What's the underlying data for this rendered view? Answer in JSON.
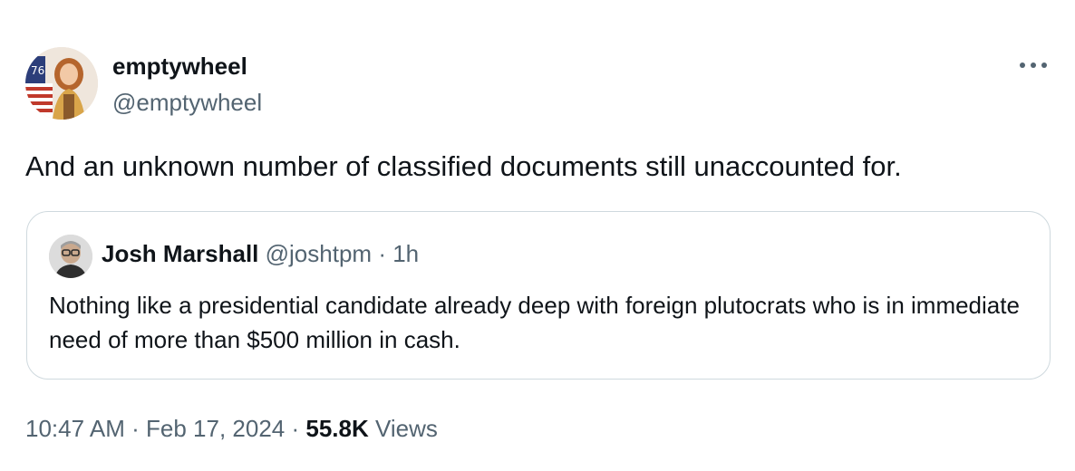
{
  "author": {
    "name": "emptywheel",
    "handle": "@emptywheel",
    "avatar_icon": "profile-photo-icon"
  },
  "more_icon": "more-options-icon",
  "tweet_text": "And an unknown number of classified documents still unaccounted for.",
  "quote": {
    "name": "Josh Marshall",
    "handle": "@joshtpm",
    "separator": "·",
    "time": "1h",
    "text": "Nothing like a presidential candidate already deep with foreign plutocrats who is in immediate need of more than $500 million in cash."
  },
  "footer": {
    "time": "10:47 AM",
    "sep1": "·",
    "date": "Feb 17, 2024",
    "sep2": "·",
    "views_count": "55.8K",
    "views_label": "Views"
  },
  "colors": {
    "text": "#0f1419",
    "secondary": "#536471",
    "border": "#cfd9de"
  }
}
